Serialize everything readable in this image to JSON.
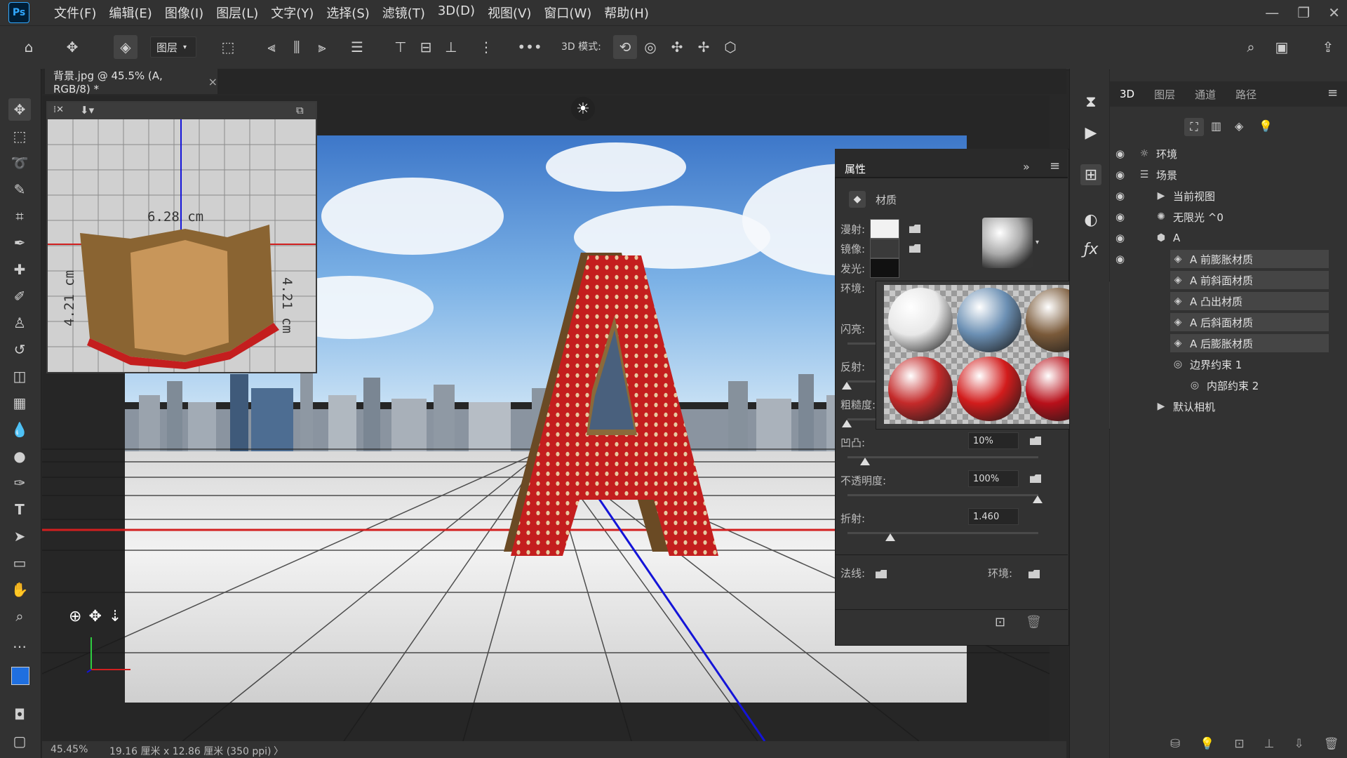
{
  "app": {
    "logo": "Ps",
    "menu": [
      "文件(F)",
      "编辑(E)",
      "图像(I)",
      "图层(L)",
      "文字(Y)",
      "选择(S)",
      "滤镜(T)",
      "3D(D)",
      "视图(V)",
      "窗口(W)",
      "帮助(H)"
    ]
  },
  "options_bar": {
    "layer_select": "图层",
    "mode_label": "3D 模式:",
    "more": "•••"
  },
  "document": {
    "tab_title": "背景.jpg @ 45.5% (A, RGB/8) *",
    "close": "×"
  },
  "navigator": {
    "dim_top": "6.28 cm",
    "dim_right": "4.21 cm",
    "dim_left": "4.21 cm"
  },
  "properties": {
    "title": "属性",
    "section": "材质",
    "labels": {
      "diffuse": "漫射:",
      "specular": "镜像:",
      "illumination": "发光:",
      "ambient": "环境:",
      "shine": "闪亮:",
      "reflection": "反射:",
      "roughness": "粗糙度:",
      "bump": "凹凸:",
      "opacity": "不透明度:",
      "refraction": "折射:",
      "normal": "法线:",
      "environment": "环境:"
    },
    "values": {
      "bump": "10%",
      "opacity": "100%",
      "refraction": "1.460"
    },
    "slider_levels": {
      "reflection": 0,
      "roughness": 0,
      "bump": 0.1,
      "opacity": 1.0,
      "refraction": 0.23
    },
    "colors": {
      "diffuse": "#f2f2f2",
      "specular": "#3a3a3a",
      "illumination": "#111111"
    }
  },
  "material_presets": [
    {
      "name": "white-sphere",
      "color": "#e8e8e8"
    },
    {
      "name": "blue-sphere",
      "color": "#6b8fb3"
    },
    {
      "name": "wood-sphere",
      "color": "#7a5a3a"
    },
    {
      "name": "red-mesh-sphere",
      "color": "#c42a2a"
    },
    {
      "name": "red-stripe-sphere",
      "color": "#d21c1c"
    },
    {
      "name": "red-glossy-sphere",
      "color": "#b8101a"
    }
  ],
  "panel_3d": {
    "tabs": [
      "3D",
      "图层",
      "通道",
      "路径"
    ],
    "active_tab": "3D",
    "tree": [
      {
        "label": "环境",
        "indent": 0,
        "eye": true,
        "highlight": false,
        "icon": "environment-icon"
      },
      {
        "label": "场景",
        "indent": 0,
        "eye": true,
        "highlight": false,
        "icon": "scene-icon"
      },
      {
        "label": "当前视图",
        "indent": 1,
        "eye": true,
        "highlight": false,
        "icon": "camera-icon"
      },
      {
        "label": "无限光 ^0",
        "indent": 1,
        "eye": true,
        "highlight": false,
        "icon": "light-icon"
      },
      {
        "label": "A",
        "indent": 1,
        "eye": true,
        "highlight": false,
        "icon": "mesh-icon"
      },
      {
        "label": "A 前膨胀材质",
        "indent": 2,
        "eye": true,
        "highlight": true,
        "icon": "material-icon"
      },
      {
        "label": "A 前斜面材质",
        "indent": 2,
        "eye": false,
        "highlight": true,
        "icon": "material-icon"
      },
      {
        "label": "A 凸出材质",
        "indent": 2,
        "eye": false,
        "highlight": true,
        "icon": "material-icon"
      },
      {
        "label": "A 后斜面材质",
        "indent": 2,
        "eye": false,
        "highlight": true,
        "icon": "material-icon"
      },
      {
        "label": "A 后膨胀材质",
        "indent": 2,
        "eye": false,
        "highlight": true,
        "icon": "material-icon"
      },
      {
        "label": "边界约束 1",
        "indent": 2,
        "eye": false,
        "highlight": false,
        "icon": "constraint-icon"
      },
      {
        "label": "内部约束 2",
        "indent": 3,
        "eye": false,
        "highlight": false,
        "icon": "constraint-icon"
      },
      {
        "label": "默认相机",
        "indent": 1,
        "eye": false,
        "highlight": false,
        "icon": "camera-icon"
      }
    ]
  },
  "status": {
    "zoom": "45.45%",
    "doc_size": "19.16 厘米 x 12.86 厘米 (350 ppi)",
    "arrow": "〉"
  },
  "colors": {
    "foreground": "#1f6fe0",
    "background": "#ffffff",
    "accent_red": "#c41e1e"
  }
}
